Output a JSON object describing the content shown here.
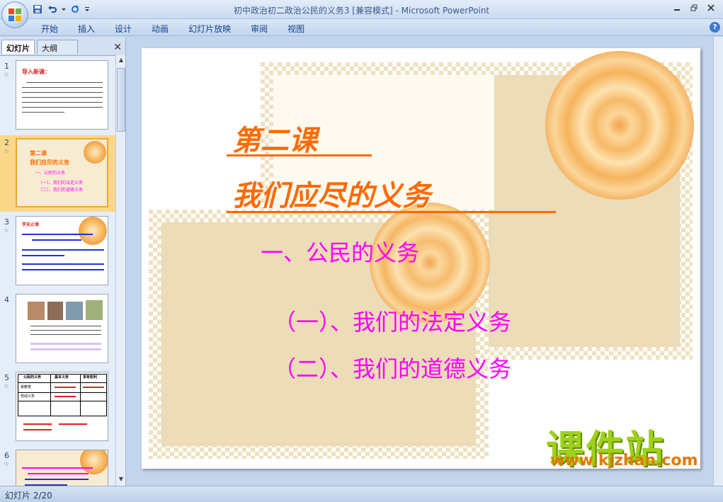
{
  "window": {
    "title": "初中政治初二政治公民的义务3 [兼容模式] - Microsoft PowerPoint"
  },
  "quick_access": {
    "save_icon": "save-icon",
    "undo_icon": "undo-icon",
    "redo_icon": "redo-icon",
    "customize_icon": "chevron-down-icon"
  },
  "ribbon": {
    "tabs": [
      "开始",
      "插入",
      "设计",
      "动画",
      "幻灯片放映",
      "审阅",
      "视图"
    ]
  },
  "left_pane": {
    "tab_slides": "幻灯片",
    "tab_outline": "大纲",
    "thumbnails": [
      {
        "num": "1",
        "star": "☆"
      },
      {
        "num": "2",
        "star": "☆"
      },
      {
        "num": "3",
        "star": "☆"
      },
      {
        "num": "4",
        "star": ""
      },
      {
        "num": "5",
        "star": "☆"
      },
      {
        "num": "6",
        "star": "☆"
      }
    ],
    "thumb_text": {
      "t1_heading": "导入新课：",
      "t2_title": "第二课",
      "t2_subtitle": "我们应尽的义务",
      "t2_point": "一、公民的义务",
      "t2_a": "（一）、我们的法定义务",
      "t2_b": "（二）、我们的道德义务",
      "t3_heading": "学无止境",
      "t5_col1": "公民的义务",
      "t5_col2": "基本义务",
      "t5_col3": "享有权利",
      "t5_r1": "受教育",
      "t5_r2": "劳动义务"
    }
  },
  "slide": {
    "lesson_title": "第二课",
    "lesson_subtitle": "我们应尽的义务",
    "point_main": "一、公民的义务",
    "point_a": "（一）、我们的法定义务",
    "point_b": "（二）、我们的道德义务",
    "watermark_cn": "课件站",
    "watermark_url": "www.kjzhan.com"
  },
  "status": {
    "text": "幻灯片 2/20"
  },
  "colors": {
    "title_orange": "#ff6a00",
    "point_magenta": "#ff00ff",
    "watermark_green": "#9fd11a"
  }
}
